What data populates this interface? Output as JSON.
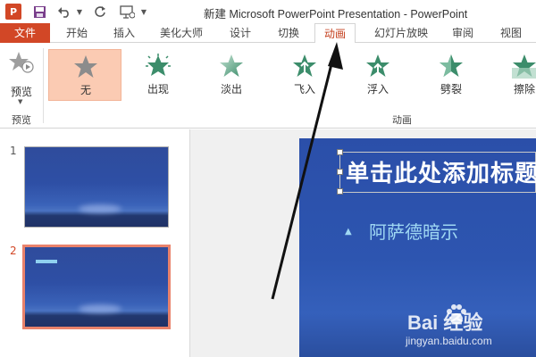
{
  "window": {
    "title": "新建 Microsoft PowerPoint Presentation - PowerPoint"
  },
  "qat": {
    "app_icon": "P"
  },
  "tabs": [
    {
      "label": "文件"
    },
    {
      "label": "开始"
    },
    {
      "label": "插入"
    },
    {
      "label": "美化大师"
    },
    {
      "label": "设计"
    },
    {
      "label": "切换"
    },
    {
      "label": "动画"
    },
    {
      "label": "幻灯片放映"
    },
    {
      "label": "审阅"
    },
    {
      "label": "视图"
    }
  ],
  "active_tab": "动画",
  "ribbon": {
    "preview_label": "预览",
    "preview_group_label": "预览",
    "animation_group_label": "动画",
    "animations": [
      {
        "label": "无",
        "icon": "star-none-icon"
      },
      {
        "label": "出现",
        "icon": "star-appear-icon"
      },
      {
        "label": "淡出",
        "icon": "star-fade-icon"
      },
      {
        "label": "飞入",
        "icon": "star-fly-in-icon"
      },
      {
        "label": "浮入",
        "icon": "star-float-in-icon"
      },
      {
        "label": "劈裂",
        "icon": "star-split-icon"
      },
      {
        "label": "擦除",
        "icon": "star-wipe-icon"
      }
    ],
    "selected_animation": "无"
  },
  "slides": [
    {
      "number": "1"
    },
    {
      "number": "2"
    }
  ],
  "selected_slide": "2",
  "slide": {
    "title": "单击此处添加标题",
    "bullet": "阿萨德暗示"
  },
  "watermark": {
    "brand": "Bai  经验",
    "sub": "jingyan.baidu.com"
  },
  "colors": {
    "accent": "#d24726",
    "selected_animation_bg": "#fbcbb3",
    "slide_blue": "#2d55b0",
    "bullet_text": "#9fd8f3"
  }
}
